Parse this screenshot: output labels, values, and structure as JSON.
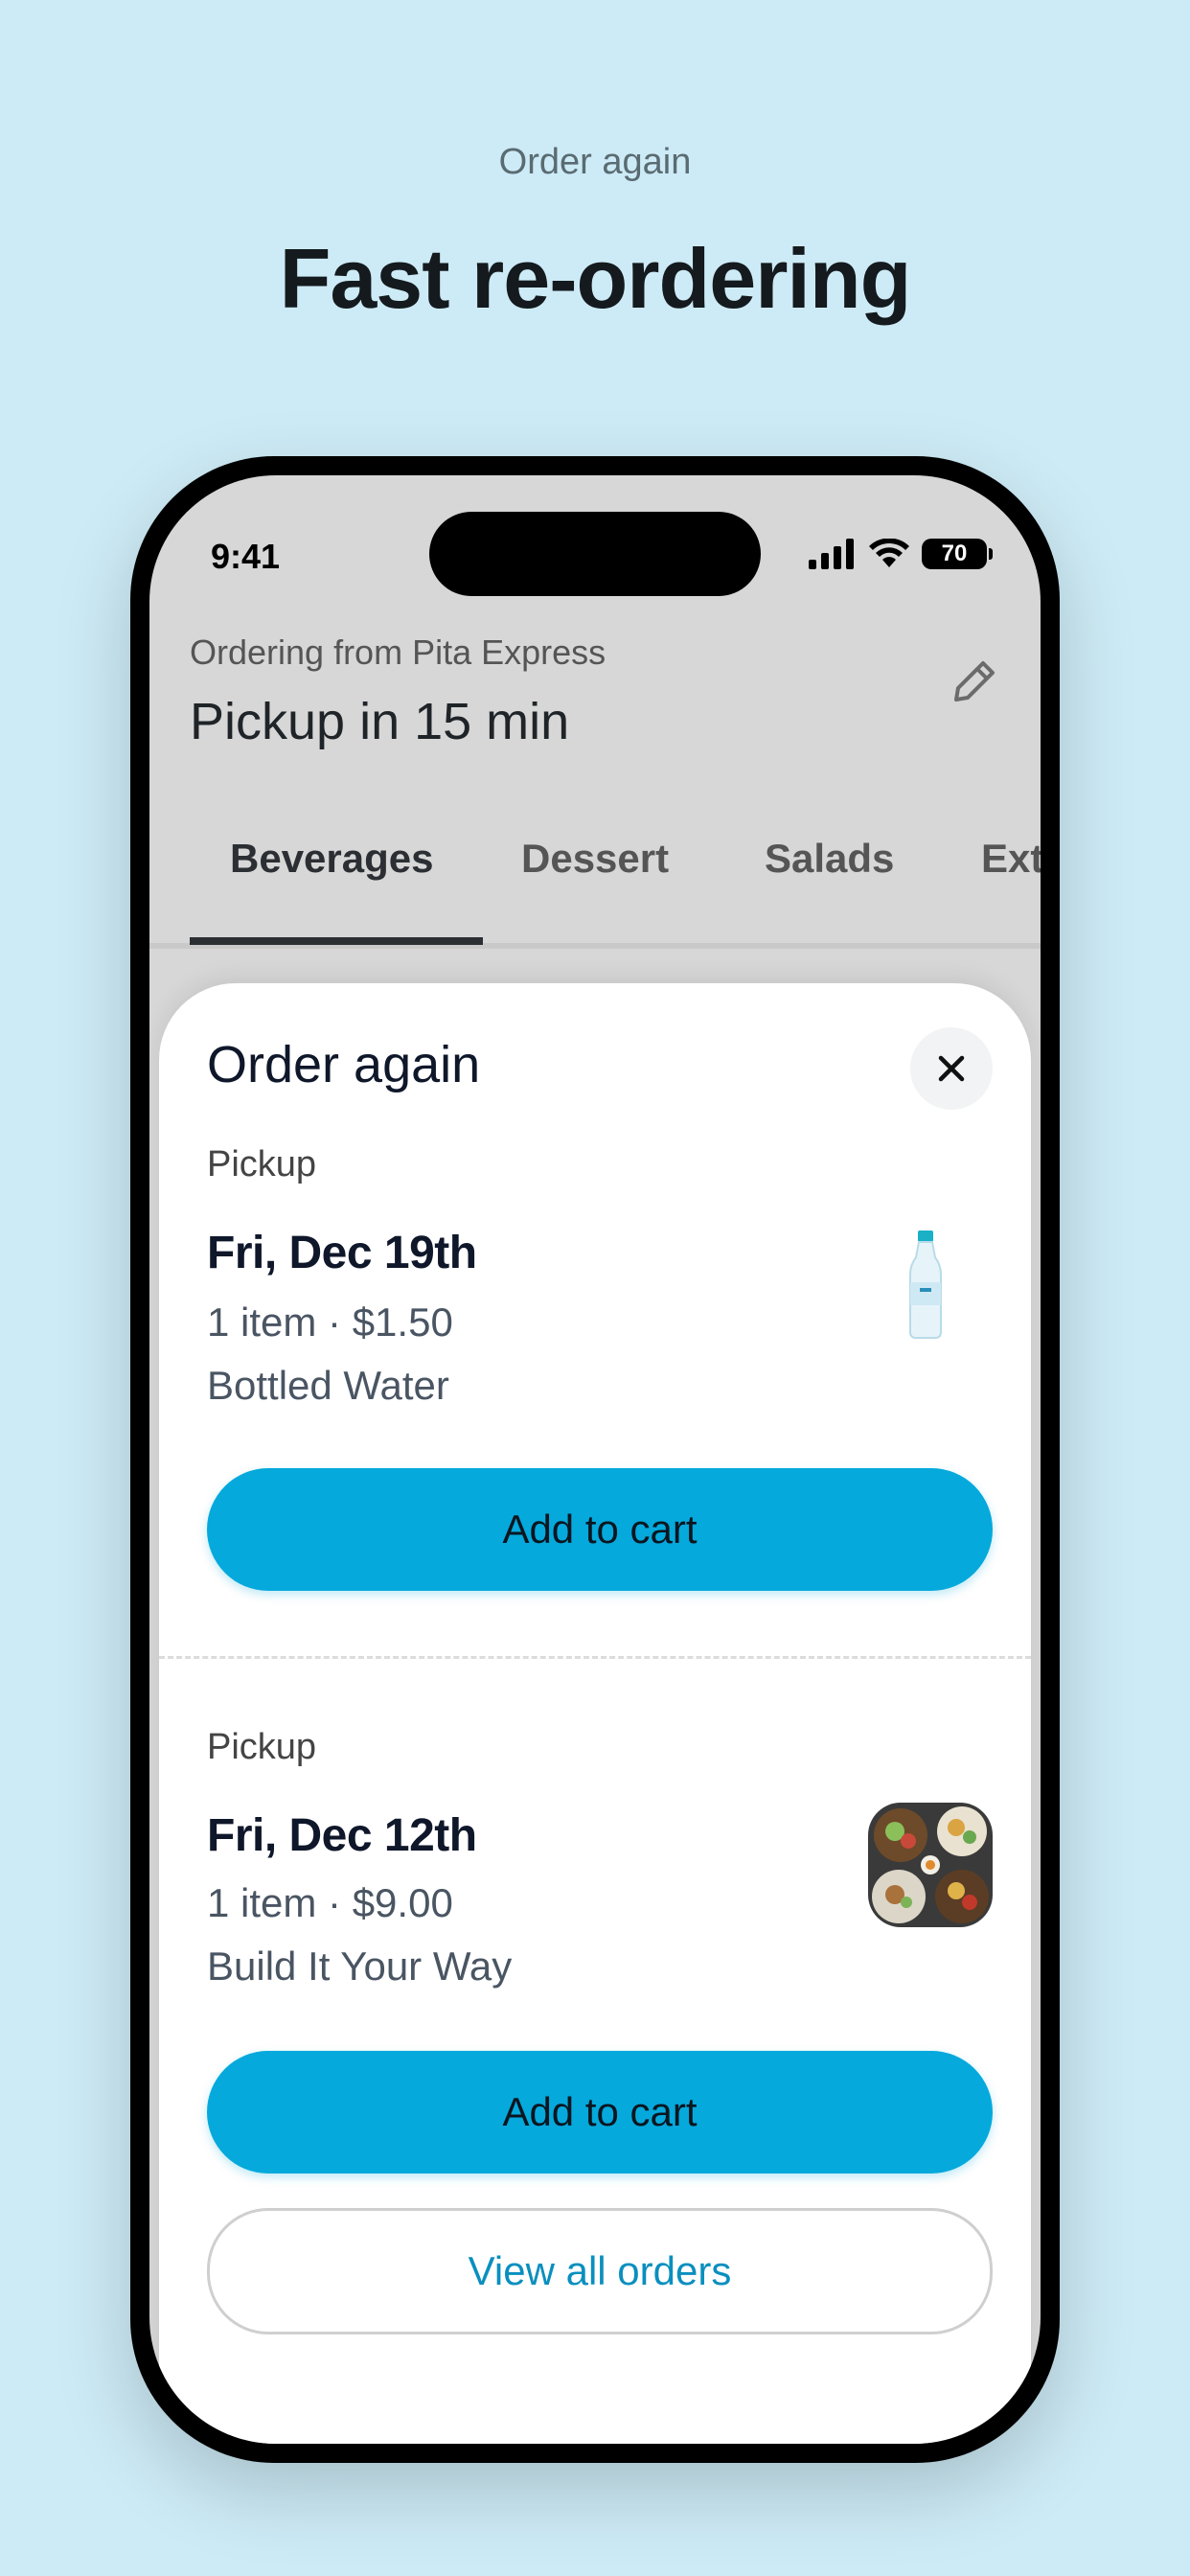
{
  "hero": {
    "eyebrow": "Order again",
    "title": "Fast re-ordering"
  },
  "status_bar": {
    "time": "9:41",
    "battery": "70"
  },
  "header": {
    "ordering_from": "Ordering from Pita Express",
    "pickup_time": "Pickup in 15 min"
  },
  "tabs": [
    {
      "label": "Beverages",
      "active": true
    },
    {
      "label": "Dessert",
      "active": false
    },
    {
      "label": "Salads",
      "active": false
    },
    {
      "label": "Ext",
      "active": false
    }
  ],
  "sheet": {
    "title": "Order again",
    "orders": [
      {
        "type": "Pickup",
        "date": "Fri, Dec 19th",
        "summary": "1 item · $1.50",
        "item": "Bottled Water",
        "image": "bottled-water-image",
        "button": "Add to cart"
      },
      {
        "type": "Pickup",
        "date": "Fri, Dec 12th",
        "summary": "1 item · $9.00",
        "item": "Build It Your Way",
        "image": "food-bowls-image",
        "button": "Add to cart"
      }
    ],
    "view_all": "View all orders"
  },
  "colors": {
    "background": "#cdebf6",
    "accent": "#05a9dc",
    "link": "#0a8fbf"
  }
}
